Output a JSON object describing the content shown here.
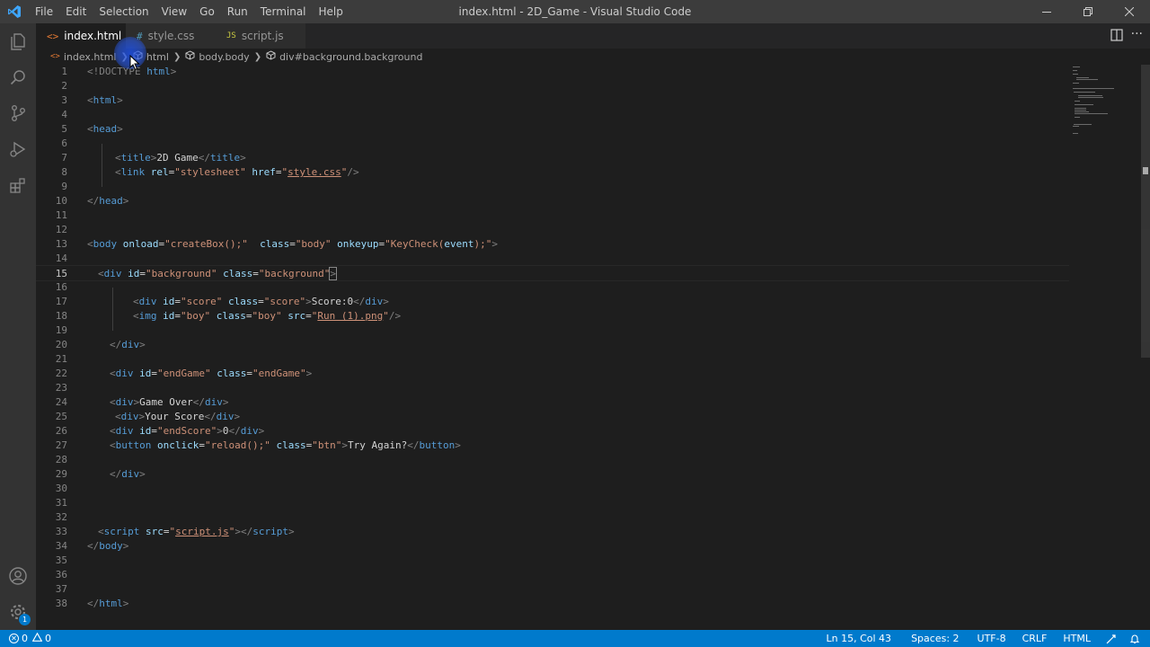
{
  "titlebar": {
    "menu": [
      "File",
      "Edit",
      "Selection",
      "View",
      "Go",
      "Run",
      "Terminal",
      "Help"
    ],
    "window_title": "index.html - 2D_Game - Visual Studio Code"
  },
  "tabs": [
    {
      "label": "index.html",
      "icon": "<>",
      "icon_color": "#e37933",
      "active": true
    },
    {
      "label": "style.css",
      "icon": "#",
      "icon_color": "#519aba",
      "active": false
    },
    {
      "label": "script.js",
      "icon": "JS",
      "icon_color": "#cbcb41",
      "active": false
    }
  ],
  "breadcrumb": [
    "index.html",
    "html",
    "body.body",
    "div#background.background"
  ],
  "editor": {
    "current_line": 15,
    "lines": [
      "1",
      "2",
      "3",
      "4",
      "5",
      "6",
      "7",
      "8",
      "9",
      "10",
      "11",
      "12",
      "13",
      "14",
      "15",
      "16",
      "17",
      "18",
      "19",
      "20",
      "21",
      "22",
      "23",
      "24",
      "25",
      "26",
      "27",
      "28",
      "29",
      "30",
      "31",
      "32",
      "33",
      "34",
      "35",
      "36",
      "37",
      "38"
    ],
    "code": {
      "l1_a": "<!DOCTYPE ",
      "l1_b": "html",
      "l1_c": ">",
      "l3_a": "<",
      "l3_b": "html",
      "l3_c": ">",
      "l5_a": "<",
      "l5_b": "head",
      "l5_c": ">",
      "l7_a": "<",
      "l7_b": "title",
      "l7_c": ">",
      "l7_d": "2D Game",
      "l7_e": "</",
      "l7_f": "title",
      "l7_g": ">",
      "l8_a": "<",
      "l8_b": "link",
      "l8_c": " rel",
      "l8_d": "=",
      "l8_e": "\"stylesheet\"",
      "l8_f": " href",
      "l8_g": "=",
      "l8_h": "\"",
      "l8_i": "style.css",
      "l8_j": "\"",
      "l8_k": "/>",
      "l10_a": "</",
      "l10_b": "head",
      "l10_c": ">",
      "l13_a": "<",
      "l13_b": "body",
      "l13_c": " onload",
      "l13_d": "=",
      "l13_e": "\"createBox();\"",
      "l13_f": "  class",
      "l13_g": "=",
      "l13_h": "\"body\"",
      "l13_i": " onkeyup",
      "l13_j": "=",
      "l13_k": "\"KeyCheck(",
      "l13_l": "event",
      "l13_m": ");\"",
      "l13_n": ">",
      "l15_a": "<",
      "l15_b": "div",
      "l15_c": " id",
      "l15_d": "=",
      "l15_e": "\"background\"",
      "l15_f": " class",
      "l15_g": "=",
      "l15_h": "\"background\"",
      "l15_i": ">",
      "l17_a": "<",
      "l17_b": "div",
      "l17_c": " id",
      "l17_d": "=",
      "l17_e": "\"score\"",
      "l17_f": " class",
      "l17_g": "=",
      "l17_h": "\"score\"",
      "l17_i": ">",
      "l17_j": "Score:0",
      "l17_k": "</",
      "l17_l": "div",
      "l17_m": ">",
      "l18_a": "<",
      "l18_b": "img",
      "l18_c": " id",
      "l18_d": "=",
      "l18_e": "\"boy\"",
      "l18_f": " class",
      "l18_g": "=",
      "l18_h": "\"boy\"",
      "l18_i": " src",
      "l18_j": "=",
      "l18_k": "\"",
      "l18_l": "Run (1).png",
      "l18_m": "\"",
      "l18_n": "/>",
      "l20_a": "</",
      "l20_b": "div",
      "l20_c": ">",
      "l22_a": "<",
      "l22_b": "div",
      "l22_c": " id",
      "l22_d": "=",
      "l22_e": "\"endGame\"",
      "l22_f": " class",
      "l22_g": "=",
      "l22_h": "\"endGame\"",
      "l22_i": ">",
      "l24_a": "<",
      "l24_b": "div",
      "l24_c": ">",
      "l24_d": "Game Over",
      "l24_e": "</",
      "l24_f": "div",
      "l24_g": ">",
      "l25_a": "<",
      "l25_b": "div",
      "l25_c": ">",
      "l25_d": "Your Score",
      "l25_e": "</",
      "l25_f": "div",
      "l25_g": ">",
      "l26_a": "<",
      "l26_b": "div",
      "l26_c": " id",
      "l26_d": "=",
      "l26_e": "\"endScore\"",
      "l26_f": ">",
      "l26_g": "0",
      "l26_h": "</",
      "l26_i": "div",
      "l26_j": ">",
      "l27_a": "<",
      "l27_b": "button",
      "l27_c": " onclick",
      "l27_d": "=",
      "l27_e": "\"reload();\"",
      "l27_f": " class",
      "l27_g": "=",
      "l27_h": "\"btn\"",
      "l27_i": ">",
      "l27_j": "Try Again?",
      "l27_k": "</",
      "l27_l": "button",
      "l27_m": ">",
      "l29_a": "</",
      "l29_b": "div",
      "l29_c": ">",
      "l33_a": "<",
      "l33_b": "script",
      "l33_c": " src",
      "l33_d": "=",
      "l33_e": "\"",
      "l33_f": "script.js",
      "l33_g": "\"",
      "l33_h": "></",
      "l33_i": "script",
      "l33_j": ">",
      "l34_a": "</",
      "l34_b": "body",
      "l34_c": ">",
      "l38_a": "</",
      "l38_b": "html",
      "l38_c": ">"
    }
  },
  "activitybar": {
    "top_icons": [
      "files-icon",
      "search-icon",
      "source-control-icon",
      "run-debug-icon",
      "extensions-icon"
    ],
    "bottom_icons": [
      "account-icon",
      "manage-gear-icon"
    ],
    "gear_badge": "1"
  },
  "statusbar": {
    "errors": "0",
    "warnings": "0",
    "position": "Ln 15, Col 43",
    "spaces": "Spaces: 2",
    "encoding": "UTF-8",
    "eol": "CRLF",
    "language": "HTML"
  },
  "colors": {
    "statusbar": "#007acc",
    "tag": "#569cd6",
    "attribute": "#9cdcfe",
    "string": "#ce9178",
    "bracket": "#808080"
  }
}
